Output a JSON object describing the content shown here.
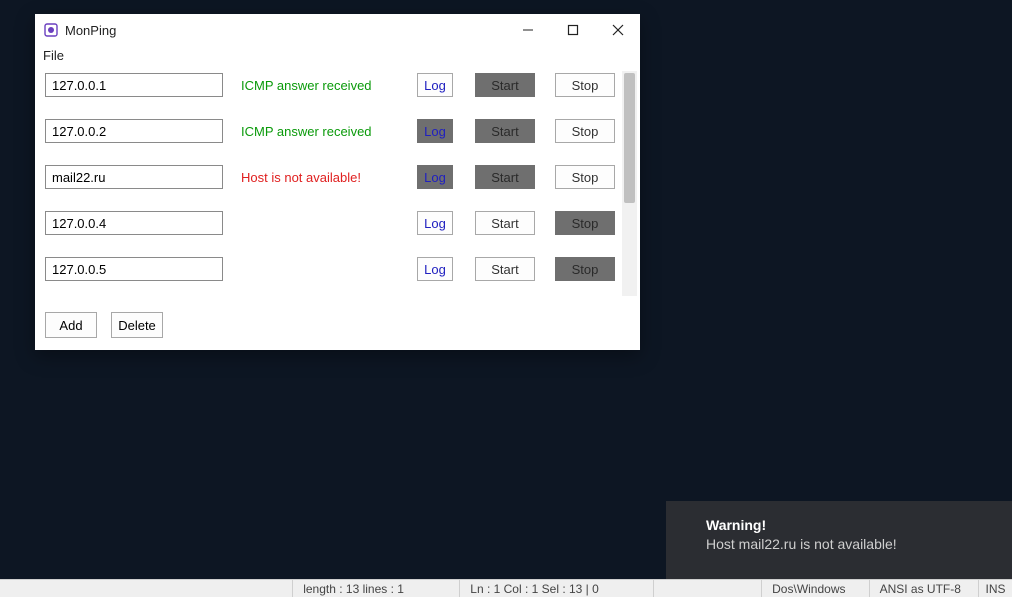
{
  "window": {
    "title": "MonPing",
    "menu": {
      "file": "File"
    }
  },
  "rows": [
    {
      "host": "127.0.0.1",
      "status": "ICMP answer received",
      "status_kind": "ok",
      "log_dark": false,
      "start_dark": true,
      "stop_dark": false
    },
    {
      "host": "127.0.0.2",
      "status": "ICMP answer received",
      "status_kind": "ok",
      "log_dark": true,
      "start_dark": true,
      "stop_dark": false
    },
    {
      "host": "mail22.ru",
      "status": "Host is not available!",
      "status_kind": "err",
      "log_dark": true,
      "start_dark": true,
      "stop_dark": false
    },
    {
      "host": "127.0.0.4",
      "status": "",
      "status_kind": "",
      "log_dark": false,
      "start_dark": false,
      "stop_dark": true
    },
    {
      "host": "127.0.0.5",
      "status": "",
      "status_kind": "",
      "log_dark": false,
      "start_dark": false,
      "stop_dark": true
    }
  ],
  "labels": {
    "log": "Log",
    "start": "Start",
    "stop": "Stop",
    "add": "Add",
    "delete": "Delete"
  },
  "toast": {
    "title": "Warning!",
    "body": "Host mail22.ru is not available!"
  },
  "statusbar": {
    "length": "length : 13    lines : 1",
    "pos": "Ln : 1    Col : 1    Sel : 13 | 0",
    "eol": "Dos\\Windows",
    "enc": "ANSI as UTF-8",
    "ins": "INS"
  }
}
